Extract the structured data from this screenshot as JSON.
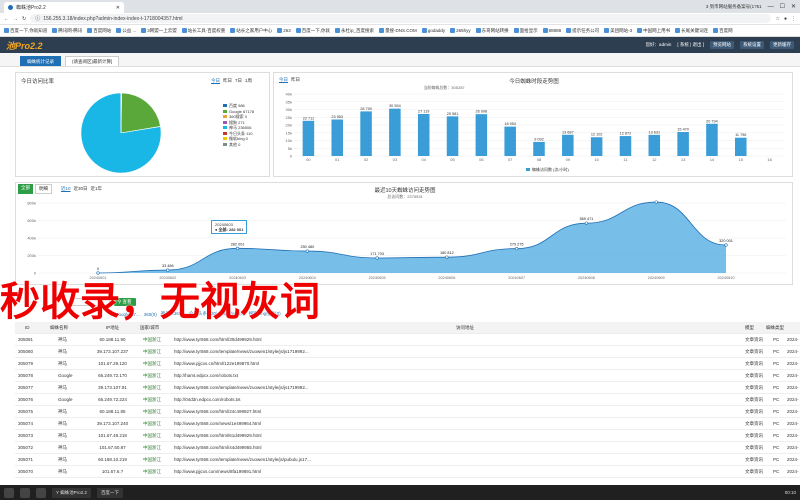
{
  "browser": {
    "tab_title": "蜘蛛池Pro2.2",
    "right_tab": "3 到币网站服务备案号(1?51",
    "url": "156.255.3.18/index.php?admin-index-index-t-1718004357.html",
    "bookmarks": [
      "百度一下,你就知道",
      "腾讯网-腾讯",
      "百度网站",
      "公益 ...",
      "3网盟一上云盟",
      "站长工具-百度权重",
      "站长之家用户中心",
      "263",
      "百度一下,你就",
      "永杜ip_百度搜索",
      "量搜-DNS.COM",
      "godaddy",
      "265hyy",
      "东哥网站转换",
      "面拾显示",
      "88888",
      "提示任务公司",
      "美团网站-3",
      "中国网上用书",
      "长尾关键词连",
      "百度网"
    ]
  },
  "app": {
    "brand": "池Pro2.2",
    "user_label": "您好：admin",
    "settings_label": "[ 系统 | 退出 ]",
    "btn_preview": "预览网站",
    "btn_settings": "系统设置",
    "btn_update": "更新缓存"
  },
  "page_tabs": [
    "蜘蛛统计记录",
    "(请查阅区)最新计算]"
  ],
  "pie_panel": {
    "title": "今日访问比率",
    "filters": [
      "今日",
      "昨日",
      "7日",
      "1周"
    ],
    "legend": [
      {
        "label": "百度 986",
        "color": "#1f6fb4"
      },
      {
        "label": "Google 67178",
        "color": "#5aa83a"
      },
      {
        "label": "360搜索 0",
        "color": "#e8a33c"
      },
      {
        "label": "搜狗 271",
        "color": "#9b59b6"
      },
      {
        "label": "神马 236506",
        "color": "#18b7e5"
      },
      {
        "label": "今日头条 110",
        "color": "#c0392b"
      },
      {
        "label": "微软bing 0",
        "color": "#f1c40f"
      },
      {
        "label": "其他 0",
        "color": "#7f8c8d"
      }
    ]
  },
  "bar_panel": {
    "filters": [
      "今日",
      "昨日"
    ],
    "title": "今日蜘蛛时段走势图",
    "subtitle": "当前蜘蛛总数：305287",
    "legend": "蜘蛛访问数 (次/小时)"
  },
  "line_panel": {
    "tabs": [
      "全部",
      "明细"
    ],
    "filters": [
      "近10",
      "近30日",
      "近1年"
    ],
    "title": "最近10天蜘蛛访问走势图",
    "subtitle": "总访问数：2375531",
    "tooltip_date": "20240603",
    "tooltip_value": "● 全部: 282 001"
  },
  "table": {
    "search_btn": "查看",
    "filters": [
      "Google(87...",
      "360(0)",
      "神马(2365...",
      "今日头条(130)",
      "微软bing(0)",
      "搜狗bing搜索(0)"
    ],
    "headers": [
      "ID",
      "蜘蛛名称",
      "IP地址",
      "国家/城市",
      "访问地址",
      "模型",
      "蜘蛛类型"
    ],
    "rows": [
      [
        "305081",
        "神马",
        "60.188.11.90",
        "中国浙江",
        "http://www.tyr568.com/html/30d499929.html",
        "文章资讯",
        "PC",
        "2024-"
      ],
      [
        "305080",
        "神马",
        "39.173.107.237",
        "中国浙江",
        "http://www.tyr568.com/template/news/zuowen1/style/js/js1719992...",
        "文章资讯",
        "PC",
        "2024-"
      ],
      [
        "305079",
        "神马",
        "101.67.29.120",
        "中国浙江",
        "http://www.pjjcxs.cn/html/122e199870.html",
        "文章资讯",
        "PC",
        "2024-"
      ],
      [
        "305078",
        "Google",
        "66.249.72.170",
        "中国浙江",
        "http://hamt.edpcx.com/robots.txt",
        "文章资讯",
        "PC",
        "2024-"
      ],
      [
        "305077",
        "神马",
        "39.173.107.91",
        "中国浙江",
        "http://www.tyr568.com/template/news/zuowen1/style/js/js1719992...",
        "文章资讯",
        "PC",
        "2024-"
      ],
      [
        "305076",
        "Google",
        "66.249.72.224",
        "中国浙江",
        "http://04d3n.edpcx.com/robots.txt",
        "文章资讯",
        "PC",
        "2024-"
      ],
      [
        "305075",
        "神马",
        "60.188.11.85",
        "中国浙江",
        "http://www.tyr568.com/html/24c499927.html",
        "文章资讯",
        "PC",
        "2024-"
      ],
      [
        "305074",
        "神马",
        "39.173.107.240",
        "中国浙江",
        "http://www.tyr568.com/news/1e499964.html",
        "文章资讯",
        "PC",
        "2024-"
      ],
      [
        "305073",
        "神马",
        "101.67.49.218",
        "中国浙江",
        "http://www.tyr568.com/html/61d499929.html",
        "文章资讯",
        "PC",
        "2024-"
      ],
      [
        "305072",
        "神马",
        "101.67.50.87",
        "中国浙江",
        "http://www.tyr568.com/html/44d499955.html",
        "文章资讯",
        "PC",
        "2024-"
      ],
      [
        "305071",
        "神马",
        "60.188.10.219",
        "中国浙江",
        "http://www.tyr568.com/template/news/zuowen1/style/js/pubulu.js17...",
        "文章资讯",
        "PC",
        "2024-"
      ],
      [
        "305070",
        "神马",
        "101.67.6.?",
        "中国浙江",
        "http://www.pjjcxs.com/news/8fa199891.html",
        "文章资讯",
        "PC",
        "2024-"
      ]
    ]
  },
  "overlay_text": "秒收录，无视灰词",
  "taskbar": {
    "time": "00:10",
    "item1": "Y 蜘蛛池Pro2.2",
    "item2": "百度一下"
  },
  "chart_data": [
    {
      "type": "pie",
      "title": "今日访问比率",
      "labels": [
        "百度",
        "Google",
        "360搜索",
        "搜狗",
        "神马",
        "今日头条",
        "微软bing",
        "其他"
      ],
      "values": [
        986,
        67178,
        0,
        271,
        236506,
        110,
        0,
        0
      ]
    },
    {
      "type": "bar",
      "title": "今日蜘蛛时段走势图",
      "categories": [
        "00",
        "01",
        "02",
        "03",
        "04",
        "05",
        "06",
        "07",
        "08",
        "09",
        "10",
        "11",
        "12",
        "13",
        "14",
        "15",
        "16"
      ],
      "values": [
        22711,
        23553,
        28790,
        30554,
        27119,
        25581,
        26998,
        18954,
        9092,
        13687,
        12102,
        12872,
        13631,
        15470,
        20794,
        11796,
        0
      ],
      "ylim": [
        0,
        40000
      ],
      "yticks": [
        "0",
        "5k",
        "10k",
        "15k",
        "20k",
        "25k",
        "30k",
        "35k",
        "40k"
      ],
      "color": "#3b9dd8"
    },
    {
      "type": "area",
      "title": "最近10天蜘蛛访问走势图",
      "categories": [
        "20240601",
        "20240602",
        "20240603",
        "20240604",
        "20240605",
        "20240606",
        "20240607",
        "20240608",
        "20240609",
        "20240610"
      ],
      "values": [
        0,
        33486,
        282001,
        250480,
        171703,
        180812,
        279275,
        569471,
        810901,
        320001
      ],
      "ylim": [
        0,
        800000
      ],
      "yticks": [
        "0",
        "200k",
        "400k",
        "600k",
        "800k"
      ],
      "color": "#4aa8e0"
    }
  ]
}
